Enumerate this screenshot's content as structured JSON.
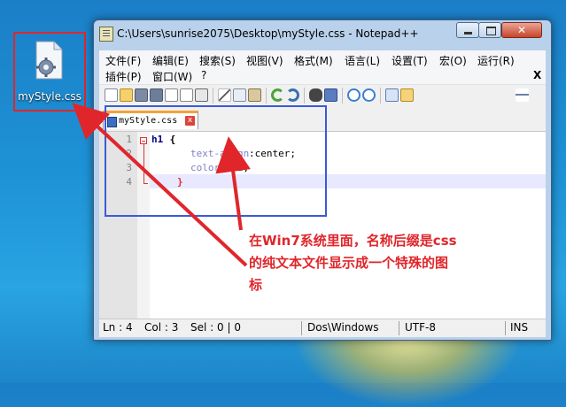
{
  "desktop": {
    "icon_label": "myStyle.css"
  },
  "window": {
    "title": "C:\\Users\\sunrise2075\\Desktop\\myStyle.css - Notepad++",
    "close_glyph": "✕"
  },
  "menu": [
    "文件(F)",
    "编辑(E)",
    "搜索(S)",
    "视图(V)",
    "格式(M)",
    "语言(L)",
    "设置(T)",
    "宏(O)",
    "运行(R)",
    "插件(P)",
    "窗口(W)",
    "?",
    "X"
  ],
  "tab": {
    "label": "myStyle.css",
    "close": "x"
  },
  "editor": {
    "line_numbers": [
      "1",
      "2",
      "3",
      "4"
    ],
    "lines": [
      {
        "sel": "h1",
        "brace": " {"
      },
      {
        "prop": "text-align",
        "val": ":center;"
      },
      {
        "prop": "color",
        "val": ":red;"
      },
      {
        "brace": "}"
      }
    ]
  },
  "status": {
    "ln": "Ln : 4",
    "col": "Col : 3",
    "sel": "Sel : 0 | 0",
    "eol": "Dos\\Windows",
    "enc": "UTF-8",
    "mode": "INS"
  },
  "annotation": [
    "在Win7系统里面，名称后缀是css",
    "的纯文本文件显示成一个特殊的图",
    "标"
  ],
  "colors": {
    "annotation": "#e0262b",
    "highlight_box": "#3a5bd6",
    "tab_accent": "#f2a33a"
  }
}
